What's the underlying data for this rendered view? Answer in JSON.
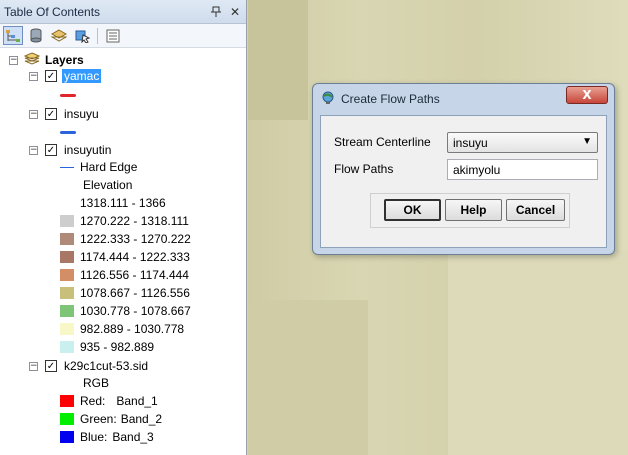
{
  "toc": {
    "title": "Table Of Contents",
    "pin_icon": "pin-icon",
    "close_icon": "close-icon",
    "root_label": "Layers",
    "layers": [
      {
        "name": "yamac",
        "checked": true,
        "selected": true,
        "line_color": "#e0262a"
      },
      {
        "name": "insuyu",
        "checked": true,
        "selected": false,
        "line_color": "#2b63d8"
      },
      {
        "name": "insuyutin",
        "checked": true,
        "hard_edge_label": "Hard Edge",
        "elevation_label": "Elevation",
        "classes": [
          {
            "label": "1318.111 - 1366",
            "color": "#ffffff"
          },
          {
            "label": "1270.222 - 1318.111",
            "color": "#cdcdcd"
          },
          {
            "label": "1222.333 - 1270.222",
            "color": "#b08a78"
          },
          {
            "label": "1174.444 - 1222.333",
            "color": "#a87766"
          },
          {
            "label": "1126.556 - 1174.444",
            "color": "#d38e66"
          },
          {
            "label": "1078.667 - 1126.556",
            "color": "#c8c07a"
          },
          {
            "label": "1030.778 - 1078.667",
            "color": "#7fc477"
          },
          {
            "label": "982.889 - 1030.778",
            "color": "#f7f7c8"
          },
          {
            "label": "935 - 982.889",
            "color": "#c9f0ef"
          }
        ]
      },
      {
        "name": "k29c1cut-53.sid",
        "checked": true,
        "rgb_label": "RGB",
        "bands": [
          {
            "channel": "Red:",
            "band": "Band_1",
            "color": "#ff0000"
          },
          {
            "channel": "Green:",
            "band": "Band_2",
            "color": "#00ee00"
          },
          {
            "channel": "Blue:",
            "band": "Band_3",
            "color": "#0000ee"
          }
        ]
      }
    ]
  },
  "dialog": {
    "title": "Create Flow Paths",
    "close_label": "X",
    "stream_label": "Stream Centerline",
    "stream_value": "insuyu",
    "flow_label": "Flow Paths",
    "flow_value": "akimyolu",
    "ok_label": "OK",
    "help_label": "Help",
    "cancel_label": "Cancel"
  }
}
